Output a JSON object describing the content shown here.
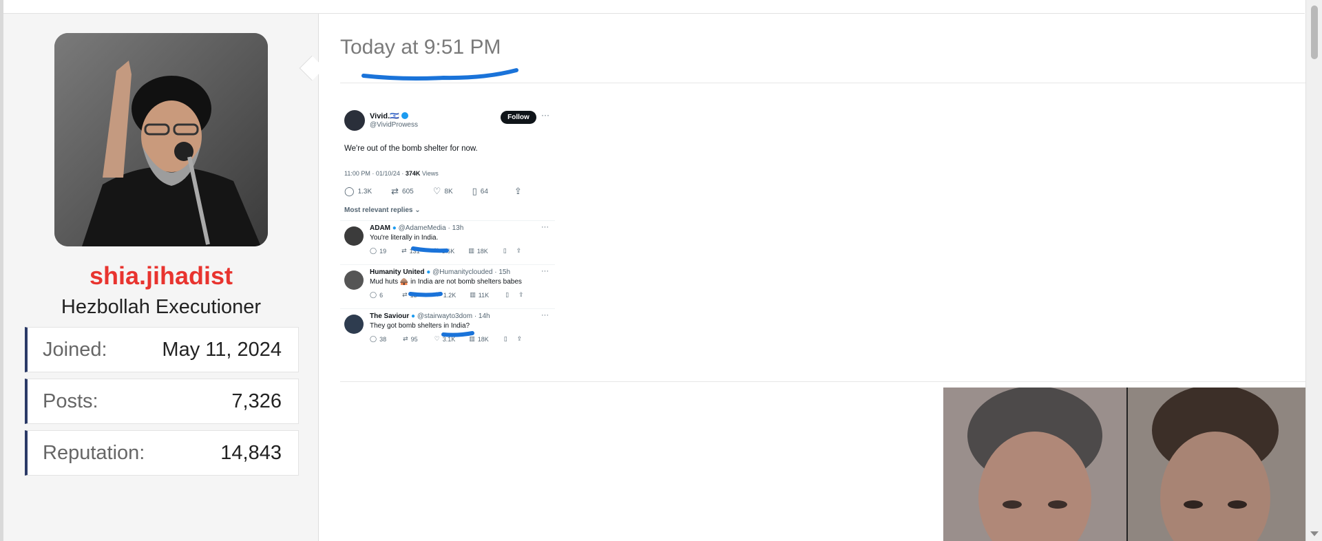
{
  "user": {
    "username": "shia.jihadist",
    "title": "Hezbollah Executioner",
    "stats": [
      {
        "label": "Joined:",
        "value": "May 11, 2024"
      },
      {
        "label": "Posts:",
        "value": "7,326"
      },
      {
        "label": "Reputation:",
        "value": "14,843"
      }
    ]
  },
  "post": {
    "date": "Today at 9:51 PM"
  },
  "tweet": {
    "author_name": "Vivid.🇮🇱",
    "author_handle": "@VividProwess",
    "follow_label": "Follow",
    "text": "We're out of the bomb shelter for now.",
    "time": "11:00 PM · 01/10/24 · ",
    "views_count": "374K",
    "views_label": " Views",
    "stats": {
      "replies": "1.3K",
      "reposts": "605",
      "likes": "8K",
      "bookmarks": "64"
    },
    "sort_label": "Most relevant replies",
    "replies": [
      {
        "name": "ADAM",
        "handle": "@AdameMedia · 13h",
        "text": "You're literally in India.",
        "replies": "19",
        "reposts": "131",
        "likes": "3.6K",
        "views": "18K"
      },
      {
        "name": "Humanity United",
        "handle": "@Humanityclouded · 15h",
        "text": "Mud huts 🛖 in India are not bomb shelters babes",
        "replies": "6",
        "reposts": "15",
        "likes": "1.2K",
        "views": "11K"
      },
      {
        "name": "The Saviour",
        "handle": "@stairwayto3dom · 14h",
        "text": "They got bomb shelters in India?",
        "replies": "38",
        "reposts": "95",
        "likes": "3.1K",
        "views": "18K"
      }
    ]
  },
  "icons": {
    "reply": "speech-bubble-icon",
    "repost": "repost-icon",
    "like": "heart-icon",
    "bookmark": "bookmark-icon",
    "share": "share-icon",
    "views": "bar-chart-icon",
    "more": "more-dots-icon",
    "verified": "verified-badge-icon"
  },
  "colors": {
    "username": "#e8342f",
    "stat_accent": "#2b3a67",
    "annotation": "#1a73d9",
    "verified": "#1d9bf0"
  }
}
